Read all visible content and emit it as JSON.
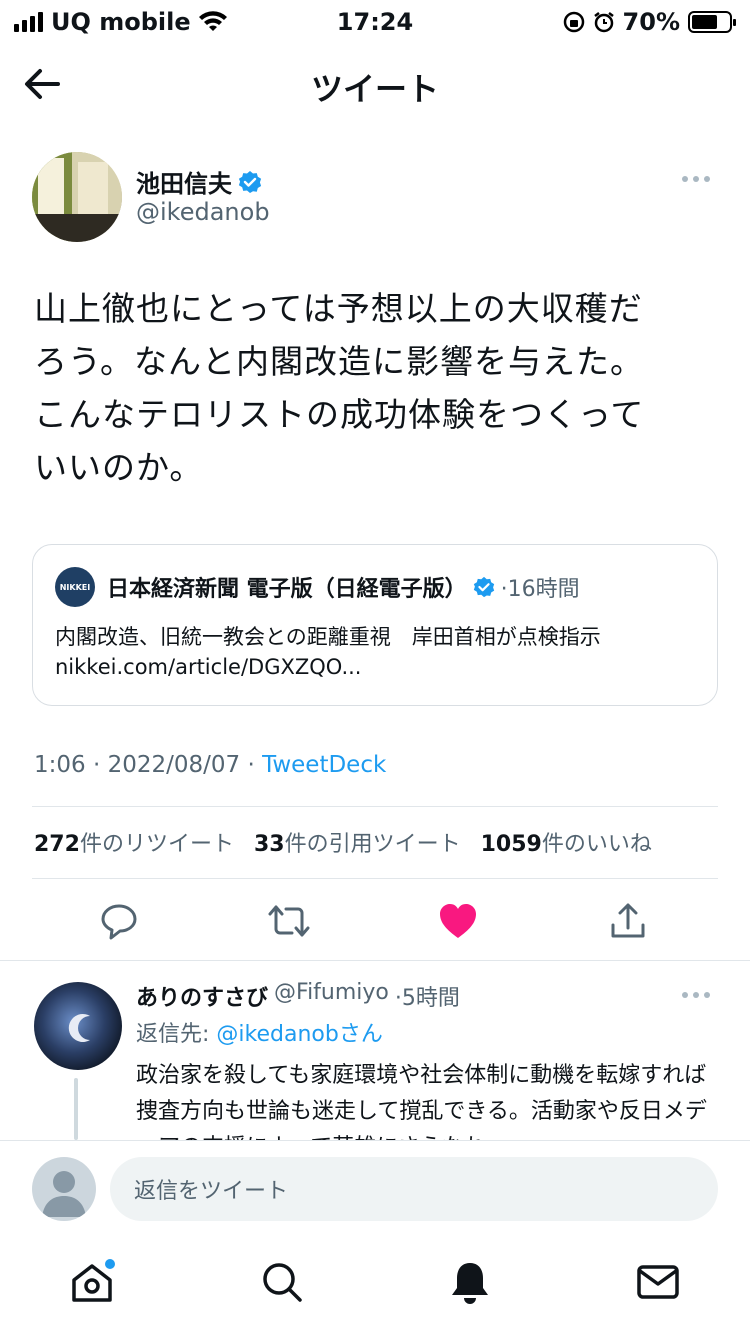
{
  "status_bar": {
    "carrier": "UQ mobile",
    "time": "17:24",
    "battery": "70%",
    "battery_level": 0.7
  },
  "header": {
    "title": "ツイート"
  },
  "tweet": {
    "author_name": "池田信夫",
    "author_handle": "@ikedanob",
    "text_lines": [
      "山上徹也にとっては予想以上の大収穫だ",
      "ろう。なんと内閣改造に影響を与えた。",
      "こんなテロリストの成功体験をつくって",
      "いいのか。"
    ],
    "quote": {
      "logo_text": "NIKKEI",
      "name": "日本経済新聞 電子版（日経電子版）",
      "time": "·16時間",
      "title": "内閣改造、旧統一教会との距離重視　岸田首相が点検指示",
      "url": "nikkei.com/article/DGXZQO..."
    },
    "timestamp": "1:06 · 2022/08/07 · ",
    "source": "TweetDeck",
    "stats": {
      "retweets_count": "272",
      "retweets_label": "件のリツイート",
      "quotes_count": "33",
      "quotes_label": "件の引用ツイート",
      "likes_count": "1059",
      "likes_label": "件のいいね"
    }
  },
  "reply": {
    "name": "ありのすさび",
    "handle": "@Fifumiyo",
    "time": "·5時間",
    "reply_to_label": "返信先: ",
    "reply_to_handle": "@ikedanobさん",
    "text": "政治家を殺しても家庭環境や社会体制に動機を転嫁すれば捜査方向も世論も迷走して撹乱できる。活動家や反日メディアの支援によって英雄にさえなれ"
  },
  "compose": {
    "placeholder": "返信をツイート"
  },
  "colors": {
    "accent": "#1d9bf0",
    "like": "#f91880",
    "secondary_text": "#536471"
  }
}
